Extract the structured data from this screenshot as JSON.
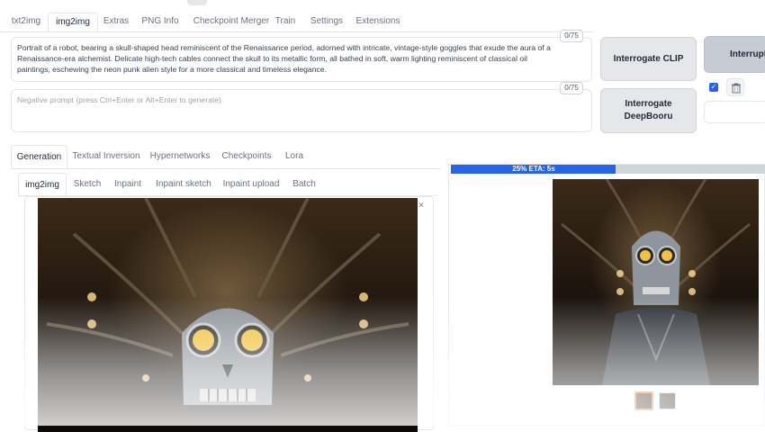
{
  "main_tabs": [
    "txt2img",
    "img2img",
    "Extras",
    "PNG Info",
    "Checkpoint Merger",
    "Train",
    "Settings",
    "Extensions"
  ],
  "prompt": {
    "value": "Portrait of a robot, bearing a skull-shaped head reminiscent of the Renaissance period, adorned with intricate, vintage-style goggles that exude the aura of a Renaissance-era alchemist. Delicate high-tech cables connect the skull to its metallic form, all bathed in soft, warm lighting reminiscent of classical oil paintings, eschewing the neon punk alien style for a more classical and timeless elegance.",
    "counter": "0/75"
  },
  "negative_prompt": {
    "placeholder": "Negative prompt (press Ctrl+Enter or Alt+Enter to generate)",
    "counter": "0/75"
  },
  "buttons": {
    "interrogate_clip": "Interrogate CLIP",
    "interrogate_deepbooru_1": "Interrogate",
    "interrogate_deepbooru_2": "DeepBooru",
    "interrupt": "Interrupt",
    "check_glyph": "✓"
  },
  "settings_tabs": [
    "Generation",
    "Textual Inversion",
    "Hypernetworks",
    "Checkpoints",
    "Lora"
  ],
  "img2img_tabs": [
    "img2img",
    "Sketch",
    "Inpaint",
    "Inpaint sketch",
    "Inpaint upload",
    "Batch"
  ],
  "progress": {
    "label": "25% ETA: 5s",
    "fraction": 0.25
  },
  "close_glyph": "×",
  "colors": {
    "accent": "#2563eb",
    "selected_thumb": "#f97316"
  }
}
